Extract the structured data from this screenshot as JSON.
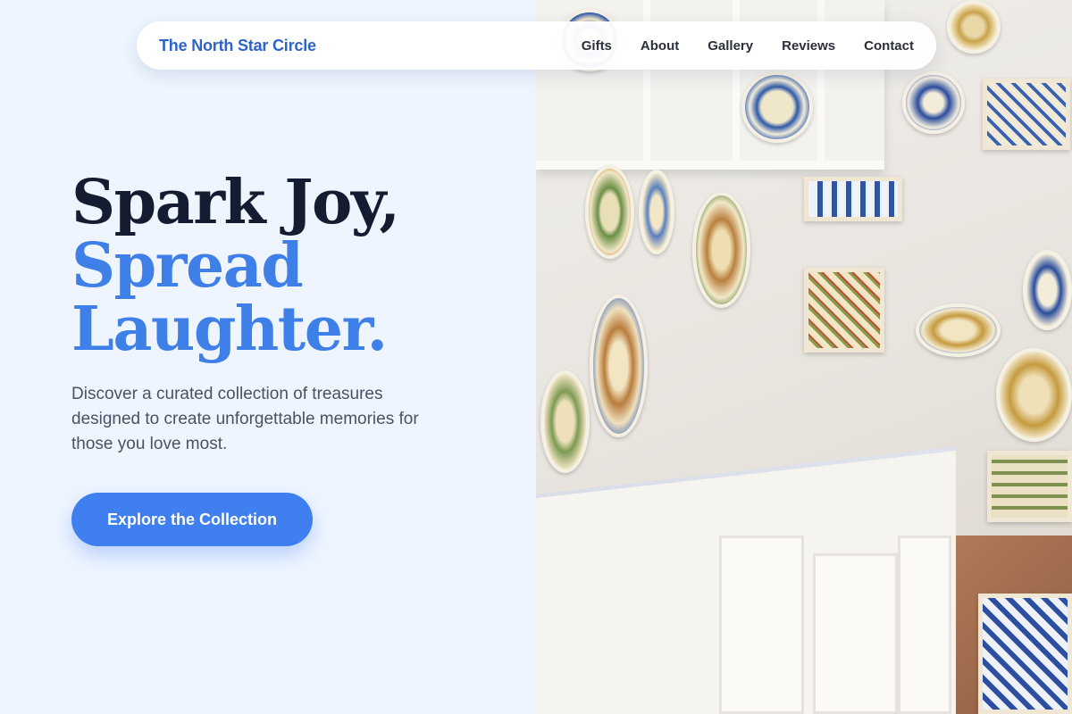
{
  "nav": {
    "brand": "The North Star Circle",
    "links": [
      "Gifts",
      "About",
      "Gallery",
      "Reviews",
      "Contact"
    ]
  },
  "hero": {
    "title_line1": "Spark Joy,",
    "title_line2": "Spread",
    "title_line3": "Laughter.",
    "description": "Discover a curated collection of treasures designed to create unforgettable memories for those you love most.",
    "cta_label": "Explore the Collection"
  },
  "colors": {
    "brand": "#2d64c8",
    "accent": "#3f7fe8",
    "heading": "#131c31",
    "background": "#eef5ff"
  }
}
